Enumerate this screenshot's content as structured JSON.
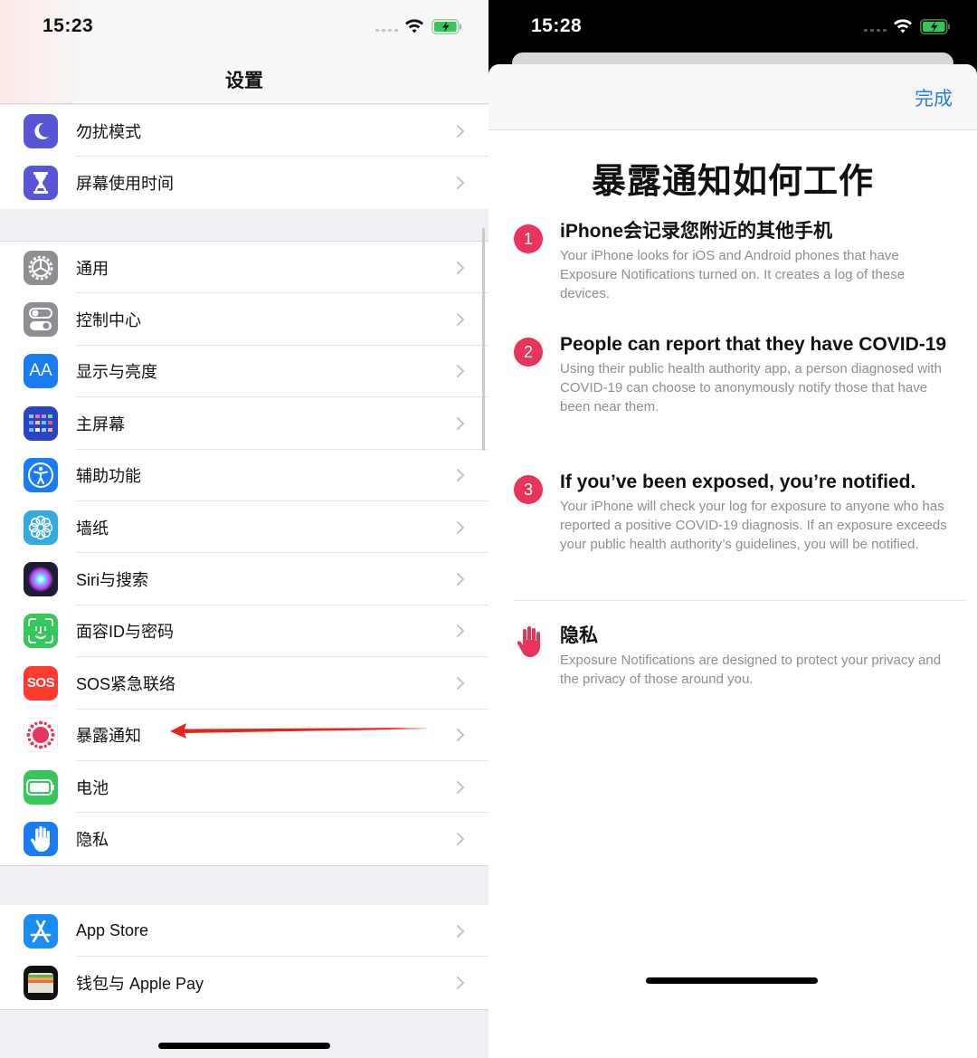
{
  "left_screen": {
    "status_bar": {
      "time": "15:23",
      "icons": [
        "signal-dots-icon",
        "wifi-icon",
        "battery-charging-icon"
      ]
    },
    "nav_title": "设置",
    "groups": [
      {
        "items": [
          {
            "label": "勿扰模式",
            "icon": "moon-icon",
            "color": "#5856d6"
          },
          {
            "label": "屏幕使用时间",
            "icon": "hourglass-icon",
            "color": "#5856d6"
          }
        ]
      },
      {
        "items": [
          {
            "label": "通用",
            "icon": "gear-icon",
            "color": "#8e8e93"
          },
          {
            "label": "控制中心",
            "icon": "toggles-icon",
            "color": "#8e8e93"
          },
          {
            "label": "显示与亮度",
            "icon": "text-size-icon",
            "color": "#1a7cf5",
            "glyph": "AA"
          },
          {
            "label": "主屏幕",
            "icon": "home-screen-grid-icon",
            "color": "#2845c7"
          },
          {
            "label": "辅助功能",
            "icon": "accessibility-icon",
            "color": "#1a7cf5"
          },
          {
            "label": "墙纸",
            "icon": "flower-icon",
            "color": "#35aadc"
          },
          {
            "label": "Siri与搜索",
            "icon": "siri-icon",
            "color": "#1c1c3a"
          },
          {
            "label": "面容ID与密码",
            "icon": "face-id-icon",
            "color": "#34c759"
          },
          {
            "label": "SOS紧急联络",
            "icon": "sos-icon",
            "color": "#ff3b30",
            "glyph": "SOS"
          },
          {
            "label": "暴露通知",
            "icon": "exposure-notification-icon",
            "color": "#ffffff"
          },
          {
            "label": "电池",
            "icon": "battery-icon",
            "color": "#34c759"
          },
          {
            "label": "隐私",
            "icon": "hand-icon",
            "color": "#1a7cf5"
          }
        ]
      },
      {
        "items": [
          {
            "label": "App Store",
            "icon": "app-store-icon",
            "color": "#1a8cf5"
          },
          {
            "label": "钱包与 Apple Pay",
            "icon": "wallet-icon",
            "color": "#111111"
          }
        ]
      }
    ],
    "annotation": {
      "type": "red-arrow",
      "points_to": "暴露通知",
      "color": "#e8231b"
    }
  },
  "right_screen": {
    "status_bar": {
      "time": "15:28",
      "icons": [
        "signal-dots-icon",
        "wifi-icon",
        "battery-charging-icon"
      ]
    },
    "done_label": "完成",
    "title": "暴露通知如何工作",
    "accent_color": "#e8335a",
    "link_color": "#2a7fd4",
    "steps": [
      {
        "number": "1",
        "heading": "iPhone会记录您附近的其他手机",
        "body": "Your iPhone looks for iOS and Android phones that have Exposure Notifications turned on. It creates a log of these devices."
      },
      {
        "number": "2",
        "heading": "People can report that they have COVID-19",
        "body": "Using their public health authority app, a person diagnosed with COVID-19 can choose to anonymously notify those that have been near them."
      },
      {
        "number": "3",
        "heading": "If you’ve been exposed, you’re notified.",
        "body": "Your iPhone will check your log for exposure to anyone who has reported a positive COVID-19 diagnosis. If an exposure exceeds your public health authority’s guidelines, you will be notified."
      }
    ],
    "privacy": {
      "heading": "隐私",
      "icon": "hand-icon",
      "body": "Exposure Notifications are designed to protect your privacy and the privacy of those around you."
    }
  }
}
